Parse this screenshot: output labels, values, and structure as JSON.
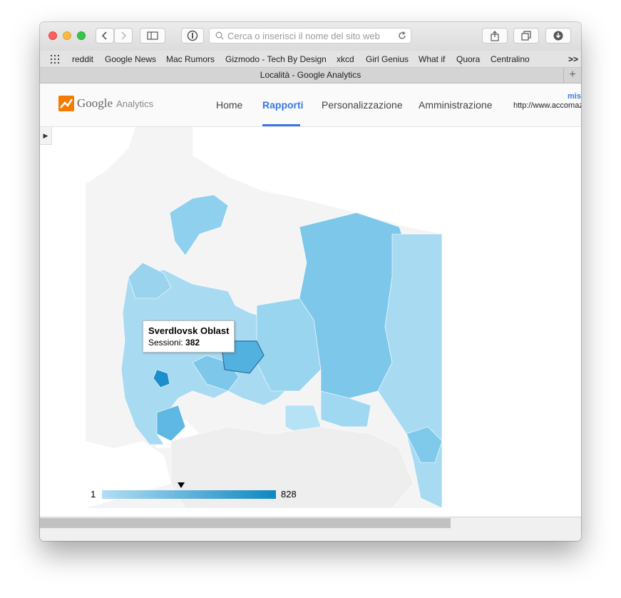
{
  "browser": {
    "url_placeholder": "Cerca o inserisci il nome del sito web",
    "tab_title": "Località - Google Analytics",
    "bookmarks": [
      "reddit",
      "Google News",
      "Mac Rumors",
      "Gizmodo - Tech By Design",
      "xkcd",
      "Girl Genius",
      "What if",
      "Quora",
      "Centralino"
    ],
    "more": ">>",
    "new_tab": "+"
  },
  "ga": {
    "logo_google": "Google",
    "logo_analytics": "Analytics",
    "nav": [
      "Home",
      "Rapporti",
      "Personalizzazione",
      "Amministrazione"
    ],
    "active_nav": "Rapporti",
    "account_name": "mis",
    "account_url": "http://www.accomaz"
  },
  "map": {
    "tooltip_region": "Sverdlovsk Oblast",
    "tooltip_metric": "Sessioni:",
    "tooltip_value": "382",
    "legend_min": "1",
    "legend_max": "828",
    "legend_marker_value": 382,
    "colors": {
      "low": "#b2def3",
      "high": "#0f87c1",
      "land": "#f4f4f4",
      "border": "#ffffff"
    }
  }
}
